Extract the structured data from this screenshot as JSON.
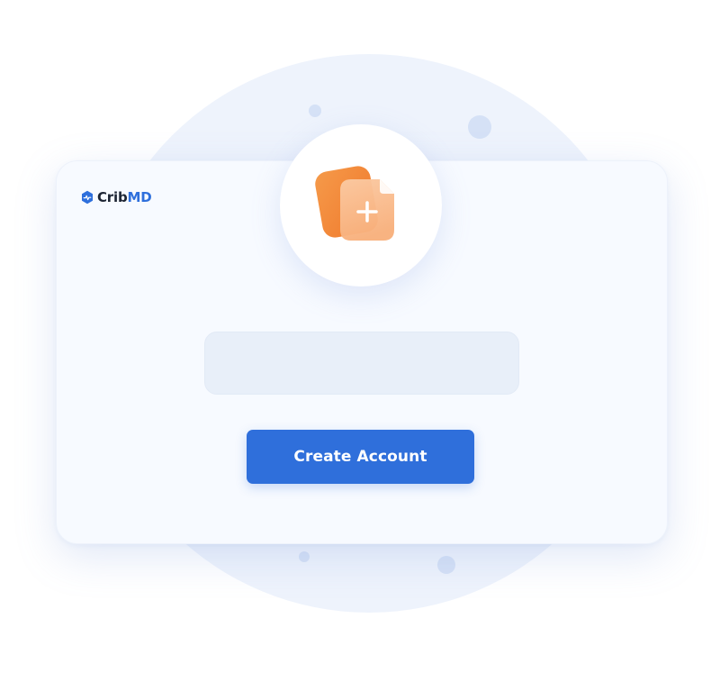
{
  "brand": {
    "name_part1": "Crib",
    "name_part2": "MD",
    "icon": "cribmd-logo-icon"
  },
  "hero": {
    "icon": "add-document-icon"
  },
  "form": {
    "field_value": "",
    "create_button_label": "Create Account"
  },
  "colors": {
    "accent_blue": "#2f6fdb",
    "icon_orange": "#f58a36",
    "background_circle": "#eef3fc",
    "card_background": "#f7faff"
  }
}
